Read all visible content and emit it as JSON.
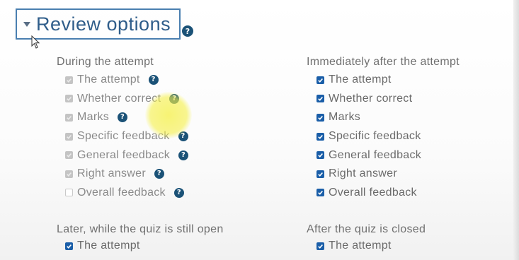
{
  "section": {
    "title": "Review options",
    "help_icon": "?"
  },
  "columns": [
    {
      "title": "During the attempt",
      "items": [
        {
          "label": "The attempt",
          "state": "disabled",
          "help": "?"
        },
        {
          "label": "Whether correct",
          "state": "disabled",
          "help": "?"
        },
        {
          "label": "Marks",
          "state": "disabled",
          "help": "?"
        },
        {
          "label": "Specific feedback",
          "state": "disabled",
          "help": "?"
        },
        {
          "label": "General feedback",
          "state": "disabled",
          "help": "?"
        },
        {
          "label": "Right answer",
          "state": "disabled",
          "help": "?"
        },
        {
          "label": "Overall feedback",
          "state": "unchecked-disabled",
          "help": "?"
        }
      ]
    },
    {
      "title": "Immediately after the attempt",
      "items": [
        {
          "label": "The attempt",
          "state": "checked"
        },
        {
          "label": "Whether correct",
          "state": "checked"
        },
        {
          "label": "Marks",
          "state": "checked"
        },
        {
          "label": "Specific feedback",
          "state": "checked"
        },
        {
          "label": "General feedback",
          "state": "checked"
        },
        {
          "label": "Right answer",
          "state": "checked"
        },
        {
          "label": "Overall feedback",
          "state": "checked"
        }
      ]
    },
    {
      "title": "Later, while the quiz is still open",
      "items": [
        {
          "label": "The attempt",
          "state": "checked"
        }
      ]
    },
    {
      "title": "After the quiz is closed",
      "items": [
        {
          "label": "The attempt",
          "state": "checked"
        }
      ]
    }
  ],
  "colors": {
    "section_title": "#2f5d8a",
    "section_border": "#4a7fb0",
    "checkbox_checked": "#1a5ea8",
    "checkbox_disabled": "#c4c4c4",
    "help_icon_bg": "#1b5277",
    "highlight": "#f5f046"
  }
}
